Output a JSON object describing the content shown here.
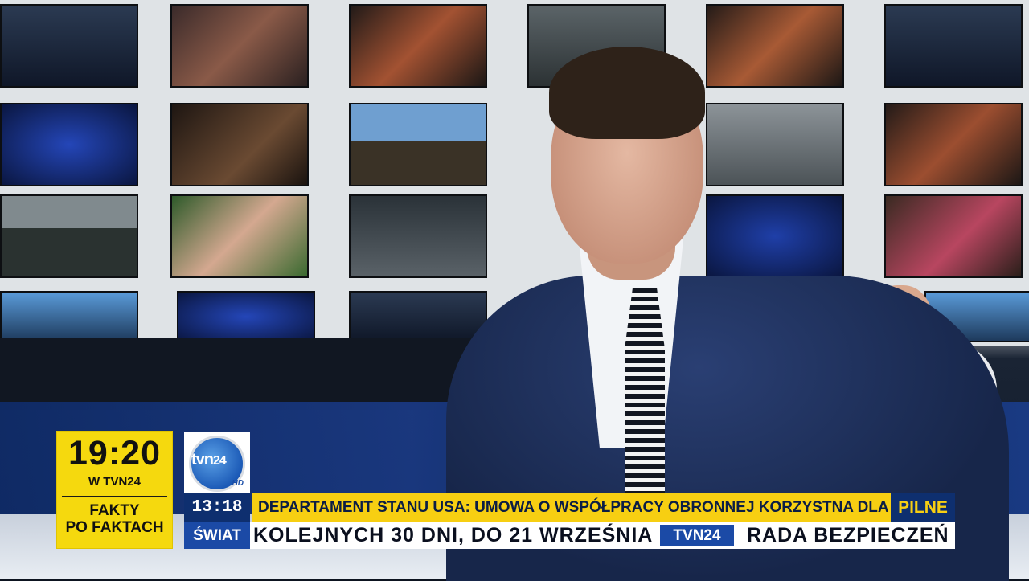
{
  "colors": {
    "accent_yellow": "#f7cf12",
    "brand_blue": "#0e2f6f",
    "section_blue": "#1b4aa6"
  },
  "clock": {
    "time": "19:20",
    "channel": "W TVN24",
    "show_line1": "FAKTY",
    "show_line2": "PO FAKTACH"
  },
  "logo": {
    "name": "tvn",
    "number": "24",
    "hd": "HD"
  },
  "lower_third": {
    "current_time": "13:18",
    "headline": "DEPARTAMENT STANU USA: UMOWA O WSPÓŁPRACY OBRONNEJ KORZYSTNA DLA NATO I DLA POLSKIEJ GOSPODARKI",
    "flag": "PILNE"
  },
  "ticker": {
    "section": "ŚWIAT",
    "text": "KOLEJNYCH 30 DNI, DO 21 WRZEŚNIA",
    "badge": "TVN24",
    "text2": "RADA BEZPIECZEŃ"
  }
}
